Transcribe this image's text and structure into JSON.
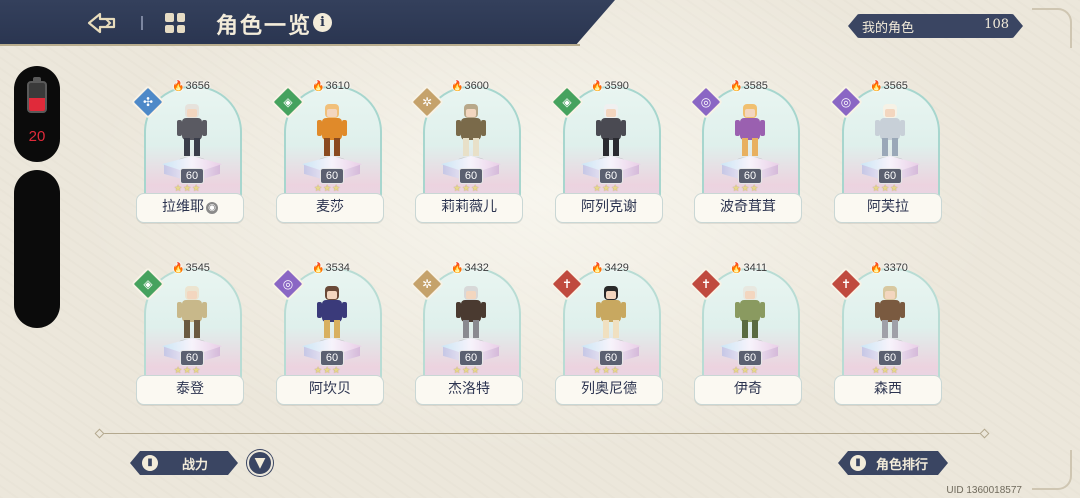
{
  "header": {
    "title": "角色一览",
    "my_characters_label": "我的角色",
    "my_characters_count": "108"
  },
  "side": {
    "stamina_value": "20",
    "stamina_fill_fraction": 0.45,
    "battery_color": "#e02a3a"
  },
  "characters": [
    {
      "name": "拉维耶",
      "power": "3656",
      "level": "60",
      "class_icon": "water-class-icon",
      "tag": true
    },
    {
      "name": "麦莎",
      "power": "3610",
      "level": "60",
      "class_icon": "earth-class-icon"
    },
    {
      "name": "莉莉薇儿",
      "power": "3600",
      "level": "60",
      "class_icon": "sun-class-icon"
    },
    {
      "name": "阿列克谢",
      "power": "3590",
      "level": "60",
      "class_icon": "earth-class-icon"
    },
    {
      "name": "波奇茸茸",
      "power": "3585",
      "level": "60",
      "class_icon": "void-class-icon"
    },
    {
      "name": "阿芙拉",
      "power": "3565",
      "level": "60",
      "class_icon": "void-class-icon"
    },
    {
      "name": "泰登",
      "power": "3545",
      "level": "60",
      "class_icon": "earth-class-icon"
    },
    {
      "name": "阿坎贝",
      "power": "3534",
      "level": "60",
      "class_icon": "void-class-icon"
    },
    {
      "name": "杰洛特",
      "power": "3432",
      "level": "60",
      "class_icon": "sun-class-icon"
    },
    {
      "name": "列奥尼德",
      "power": "3429",
      "level": "60",
      "class_icon": "fire-class-icon"
    },
    {
      "name": "伊奇",
      "power": "3411",
      "level": "60",
      "class_icon": "fire-class-icon"
    },
    {
      "name": "森西",
      "power": "3370",
      "level": "60",
      "class_icon": "fire-class-icon"
    }
  ],
  "bottom": {
    "sort_label": "战力",
    "ranking_label": "角色排行",
    "uid": "UID 1360018577"
  },
  "colors": {
    "header_bg": "#2a3550",
    "accent_red": "#e02a3a",
    "pill_bg": "#3a4562"
  }
}
